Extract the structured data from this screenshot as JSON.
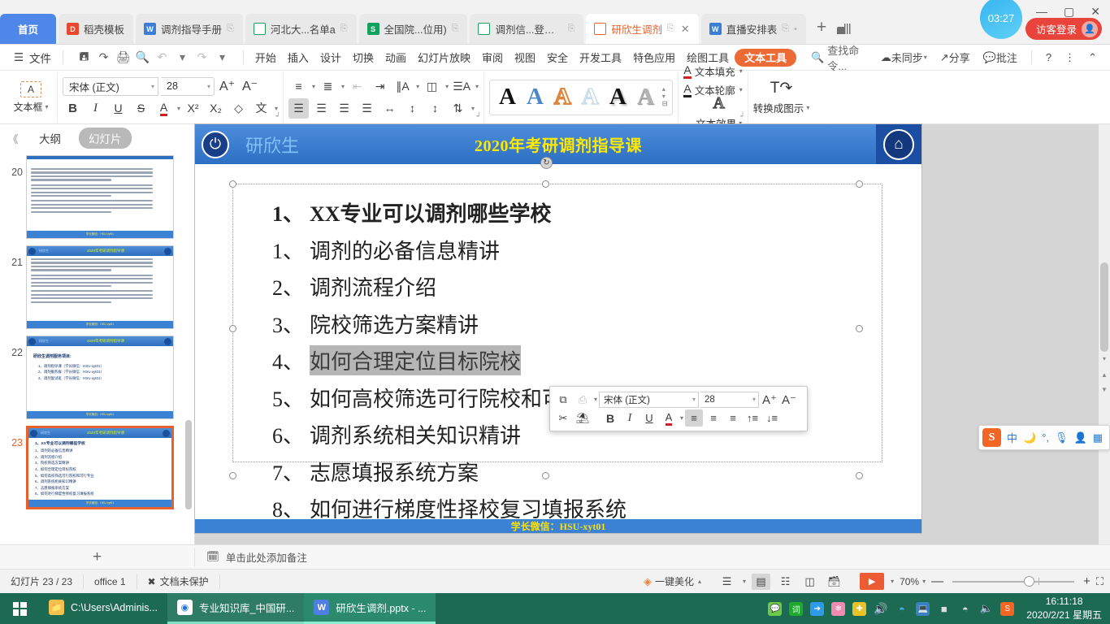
{
  "window": {
    "clock_bubble": "03:27",
    "guest_login": "访客登录",
    "minimize": "—",
    "maximize": "▢",
    "close": "✕"
  },
  "tabs": [
    {
      "label": "首页",
      "icon": "home-tab",
      "kind": "home"
    },
    {
      "label": "稻壳模板",
      "icon": "docer-icon",
      "kind": "docer"
    },
    {
      "label": "调剂指导手册",
      "icon": "writer-icon",
      "kind": "w",
      "pin": "⎘"
    },
    {
      "label": "河北大...名单a",
      "icon": "spreadsheet-icon",
      "kind": "s",
      "pin": "⎘"
    },
    {
      "label": "全国院...位用)",
      "icon": "spreadsheet-icon",
      "kind": "s2",
      "pin": "⎘"
    },
    {
      "label": "调剂信...登记表",
      "icon": "spreadsheet-icon",
      "kind": "s",
      "pin": "⎘"
    },
    {
      "label": "研欣生调剂",
      "icon": "presentation-icon",
      "kind": "p",
      "pin": "⎘",
      "close": "✕",
      "active": true
    },
    {
      "label": "直播安排表",
      "icon": "writer-icon",
      "kind": "w2",
      "pin": "⎘",
      "dot": "•"
    }
  ],
  "tab_add": "+",
  "menu": {
    "file": "文件",
    "quick_access": [
      "save-icon",
      "save-as-icon",
      "print-icon",
      "print-preview-icon",
      "undo-icon",
      "redo-icon",
      "customize-icon"
    ],
    "items": [
      "开始",
      "插入",
      "设计",
      "切换",
      "动画",
      "幻灯片放映",
      "审阅",
      "视图",
      "安全",
      "开发工具",
      "特色应用",
      "绘图工具"
    ],
    "active_item": "文本工具",
    "find_placeholder": "查找命令...",
    "right": [
      "未同步",
      "分享",
      "批注"
    ],
    "help": "?",
    "more": "⋮",
    "collapse": "⌃"
  },
  "ribbon": {
    "textbox_label": "文本框",
    "font_name": "宋体 (正文)",
    "font_size": "28",
    "grow_font": "A⁺",
    "shrink_font": "A⁻",
    "bold": "B",
    "italic": "I",
    "underline": "U",
    "strike": "S",
    "font_color": "A",
    "superscript": "X²",
    "subscript": "X₂",
    "clear_format": "◇",
    "phonetic": "文",
    "text_fill": "文本填充",
    "text_outline": "文本轮廓",
    "text_effects": "文本效果",
    "convert_to_smartart": "转换成图示"
  },
  "left_pane": {
    "collapse": "《",
    "tab_outline": "大纲",
    "tab_slides": "幻灯片",
    "selected_tab": "幻灯片",
    "thumbnails": [
      {
        "number": "20",
        "kind": "text"
      },
      {
        "number": "21",
        "kind": "text"
      },
      {
        "number": "22",
        "kind": "list",
        "heading": "研欣生调剂服务项目:",
        "lines": [
          "1、调剂指导课（学长微信：HSU-xyt01）",
          "2、调剂服务群（学长微信：HSU-xyt01）",
          "3、调剂复试班（学长微信：HSU-xyt01）"
        ]
      },
      {
        "number": "23",
        "kind": "current"
      }
    ],
    "add_slide": "+"
  },
  "slide": {
    "brand": "研欣生",
    "title": "2020年考研调剂指导课",
    "footer": "学长微信：HSU-xyt01",
    "bullets": [
      {
        "n": "1、",
        "text": "XX专业可以调剂哪些学校",
        "bold": true
      },
      {
        "n": "1、",
        "text": "调剂的必备信息精讲"
      },
      {
        "n": "2、",
        "text": "调剂流程介绍"
      },
      {
        "n": "3、",
        "text": "院校筛选方案精讲"
      },
      {
        "n": "4、",
        "text": "如何合理定位目标院校",
        "selected": true
      },
      {
        "n": "5、",
        "text": "如何高校筛选可行院校和可行专业"
      },
      {
        "n": "6、",
        "text": "调剂系统相关知识精讲"
      },
      {
        "n": "7、",
        "text": "志愿填报系统方案"
      },
      {
        "n": "8、",
        "text": "如何进行梯度性择校复习填报系统"
      }
    ]
  },
  "mini_toolbar": {
    "copy": "⧉",
    "paste": "📋",
    "font_name": "宋体 (正文)",
    "font_size": "28",
    "grow_font": "A⁺",
    "shrink_font": "A⁻",
    "cut": "✂",
    "format_painter": "🖌",
    "bold": "B",
    "italic": "I",
    "underline": "U",
    "font_color": "A",
    "align_left": "≡",
    "align_center": "≡",
    "align_right": "≡",
    "line_up": "↑≡",
    "line_down": "↓≡"
  },
  "notes": {
    "add_slide": "+",
    "placeholder": "单击此处添加备注"
  },
  "status": {
    "slide_counter": "幻灯片 23 / 23",
    "office": "office 1",
    "protection": "文档未保护",
    "beautify": "一键美化",
    "zoom": "70%",
    "zoom_out": "—",
    "zoom_in": "+",
    "fit": "⛶",
    "views": [
      "normal-view",
      "slide-sorter-view",
      "reading-view",
      "notes-view"
    ],
    "play": "▶"
  },
  "ime": {
    "logo": "S",
    "mode": "中",
    "items": [
      "moon-icon",
      "punctuation-icon",
      "microphone-icon",
      "user-icon",
      "toolbox-icon"
    ]
  },
  "taskbar": {
    "start": "start-icon",
    "buttons": [
      {
        "label": "C:\\Users\\Adminis...",
        "icon": "folder-icon"
      },
      {
        "label": "专业知识库_中国研...",
        "icon": "chrome-icon"
      },
      {
        "label": "研欣生调剂.pptx - ...",
        "icon": "wps-icon"
      }
    ],
    "tray": [
      "wechat-icon",
      "dictionary-icon",
      "cursor-icon",
      "flower-icon",
      "update-icon",
      "volume-icon",
      "bluetooth-icon",
      "network-icon",
      "battery-icon",
      "wifi-icon",
      "speaker-icon",
      "sogou-icon"
    ],
    "time": "16:11:18",
    "date": "2020/2/21 星期五"
  }
}
